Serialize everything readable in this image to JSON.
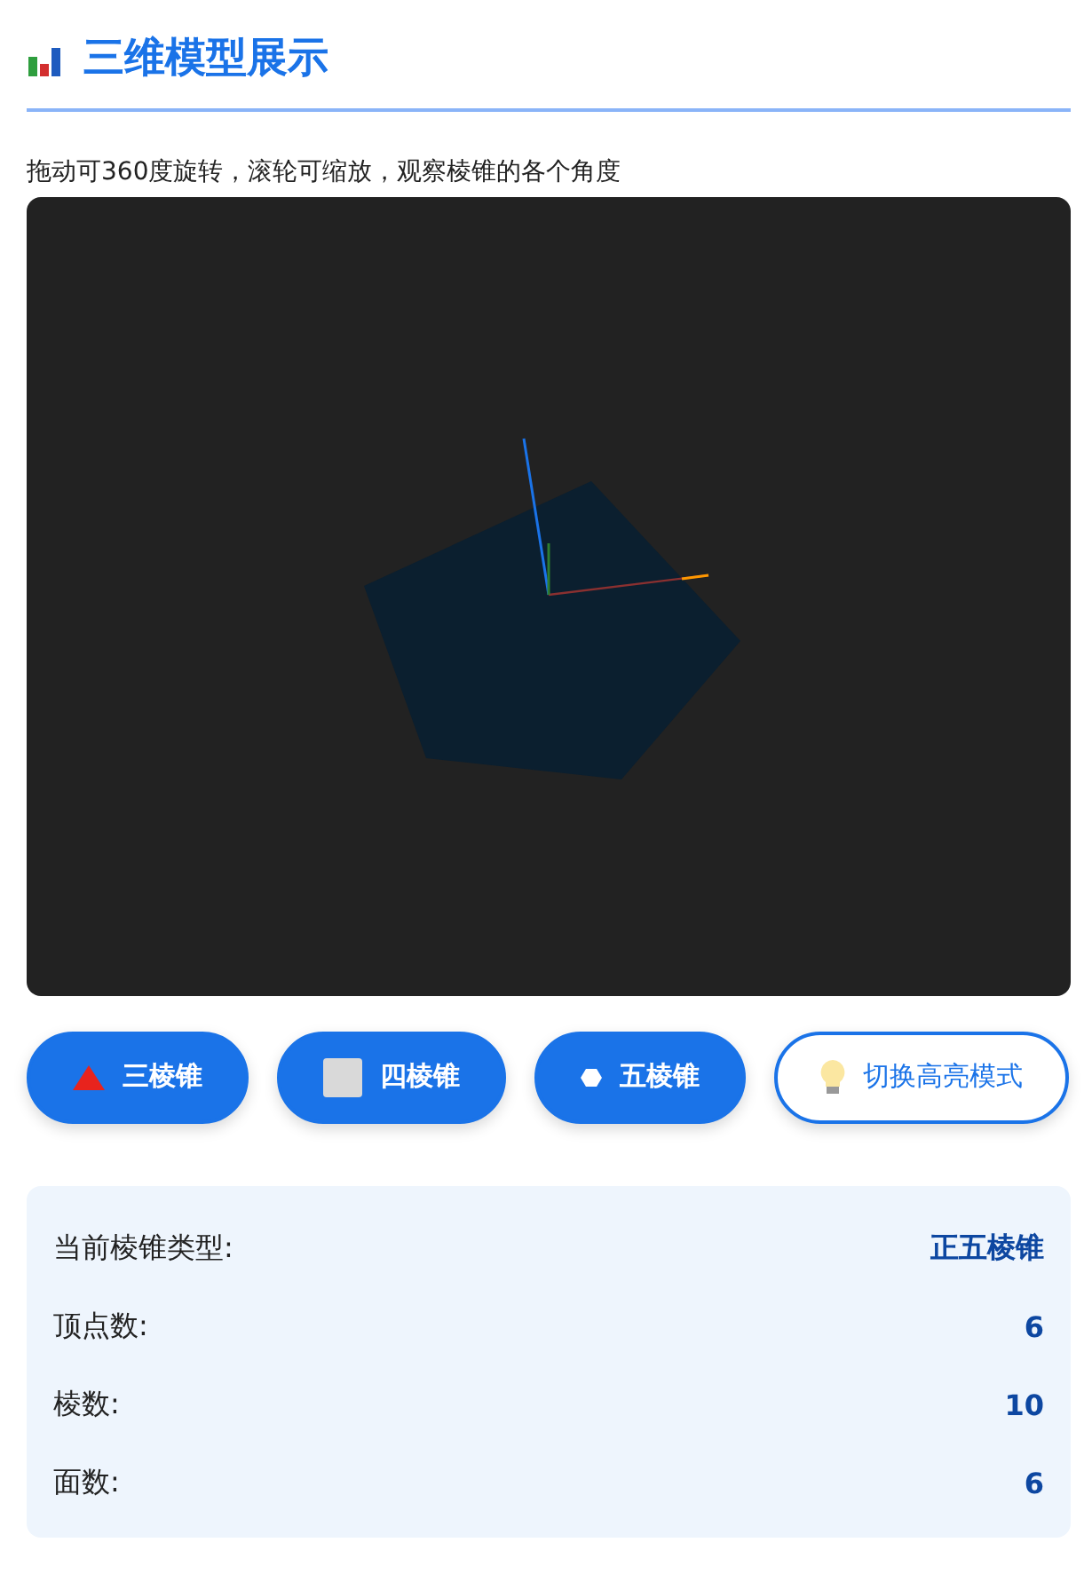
{
  "header": {
    "title": "三维模型展示"
  },
  "hint": "拖动可360度旋转，滚轮可缩放，观察棱锥的各个角度",
  "viewer": {
    "kind": "pentagonal-pyramid"
  },
  "buttons": [
    {
      "label": "三棱锥",
      "kind": "filled"
    },
    {
      "label": "四棱锥",
      "kind": "filled"
    },
    {
      "label": "五棱锥",
      "kind": "filled"
    },
    {
      "label": "切换高亮模式",
      "kind": "outline"
    }
  ],
  "info": [
    {
      "label": "当前棱锥类型:",
      "value": "正五棱锥"
    },
    {
      "label": "顶点数:",
      "value": "6"
    },
    {
      "label": "棱数:",
      "value": "10"
    },
    {
      "label": "面数:",
      "value": "6"
    }
  ]
}
